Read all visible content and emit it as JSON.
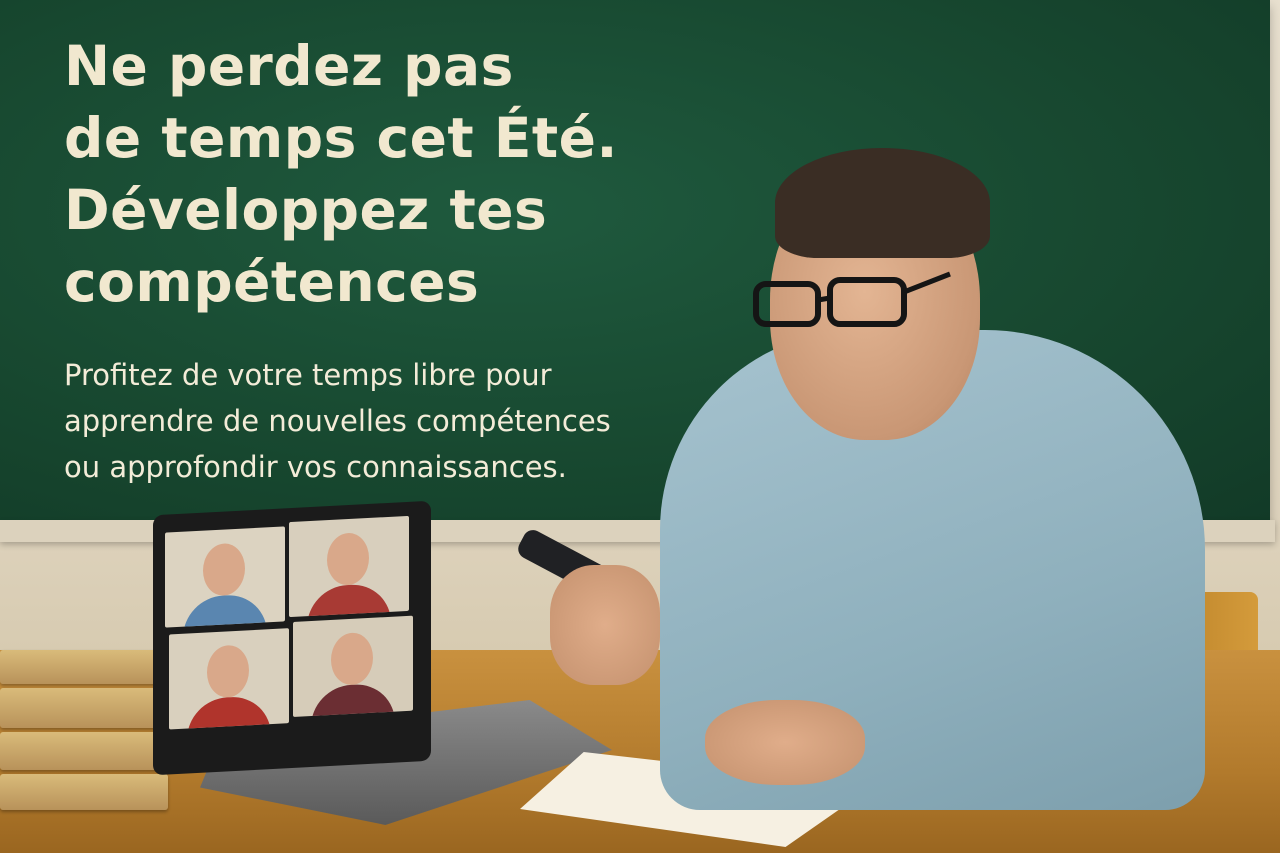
{
  "headline": {
    "line1": "Ne perdez pas",
    "line2": "de temps cet Été.",
    "line3": "Développez tes",
    "line4": "compétences"
  },
  "subtext": {
    "line1": "Profitez de votre temps libre pour",
    "line2": "apprendre de nouvelles compétences",
    "line3": "ou approfondir vos connaissances."
  },
  "colors": {
    "chalkboard": "#17472f",
    "text": "#f1e8cf",
    "desk": "#b27a2c",
    "shirt": "#8fb0bd"
  }
}
